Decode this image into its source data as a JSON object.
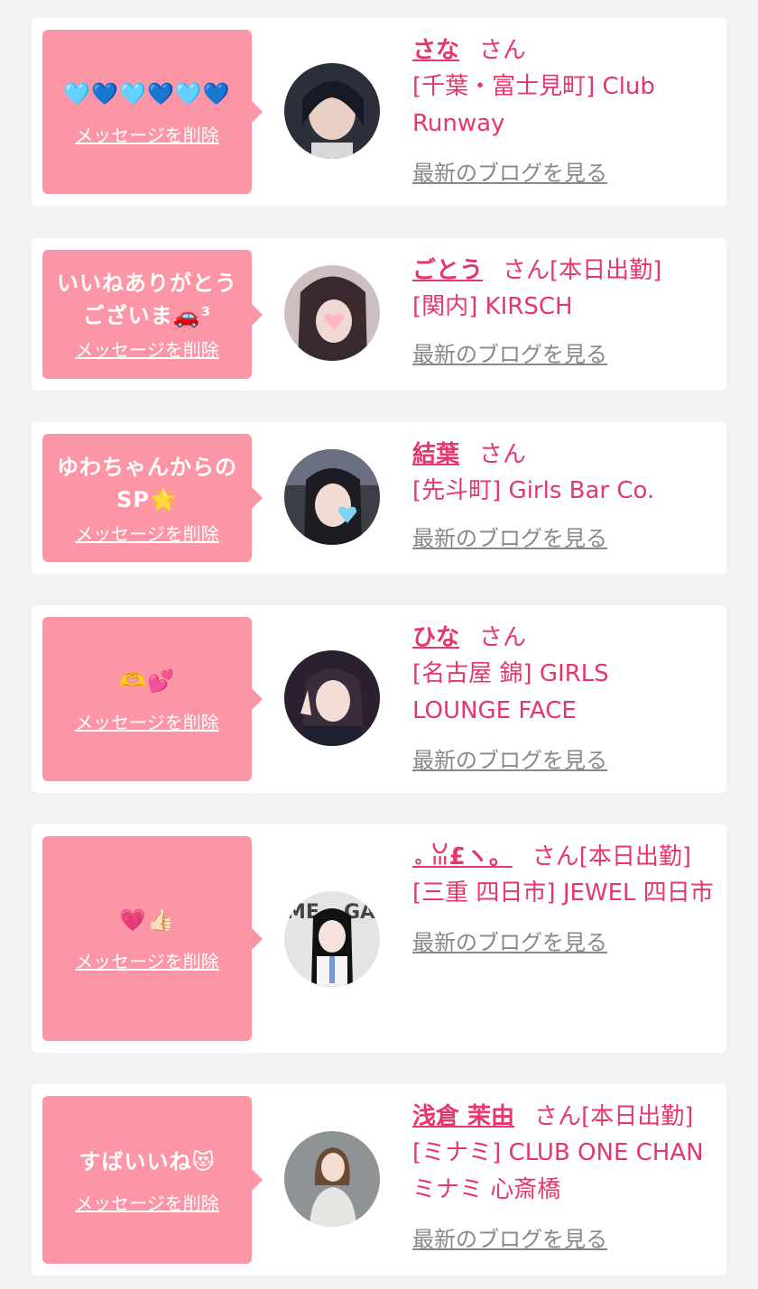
{
  "colors": {
    "background": "#f2f2f2",
    "card": "#ffffff",
    "bubble": "#fc95a5",
    "accent": "#e5376a",
    "muted": "#888888"
  },
  "cards": [
    {
      "message": "🩵💙🩵💙🩵💙",
      "delete_label": "メッセージを削除",
      "name": "さな",
      "suffix": "さん",
      "shop": "[千葉・富士見町] Club Runway",
      "blog_label": "最新のブログを見る",
      "avatar_icon": "profile-photo"
    },
    {
      "message": "いいねありがとうございま🚗³",
      "delete_label": "メッセージを削除",
      "name": "ごとう",
      "suffix": "さん[本日出勤]",
      "shop": "[関内] KIRSCH",
      "blog_label": "最新のブログを見る",
      "avatar_icon": "profile-photo"
    },
    {
      "message": "ゆわちゃんからのSP🌟",
      "delete_label": "メッセージを削除",
      "name": "結葉",
      "suffix": "さん",
      "shop": "[先斗町] Girls Bar Co.",
      "blog_label": "最新のブログを見る",
      "avatar_icon": "profile-photo"
    },
    {
      "message": "🫶💕",
      "delete_label": "メッセージを削除",
      "name": "ひな",
      "suffix": "さん",
      "shop": "[名古屋 錦] GIRLS LOUNGE FACE",
      "blog_label": "最新のブログを見る",
      "avatar_icon": "profile-photo"
    },
    {
      "message": "💗👍🏻",
      "delete_label": "メッセージを削除",
      "name": "。ꈍ£ヽ。",
      "suffix": "さん[本日出勤]",
      "shop": "[三重 四日市] JEWEL 四日市",
      "blog_label": "最新のブログを見る",
      "avatar_icon": "profile-photo"
    },
    {
      "message": "すばいいね😻",
      "delete_label": "メッセージを削除",
      "name": "浅倉 茉由",
      "suffix": "さん[本日出勤]",
      "shop": "[ミナミ] CLUB ONE CHAN ミナミ 心斎橋",
      "blog_label": "最新のブログを見る",
      "avatar_icon": "profile-photo"
    }
  ]
}
